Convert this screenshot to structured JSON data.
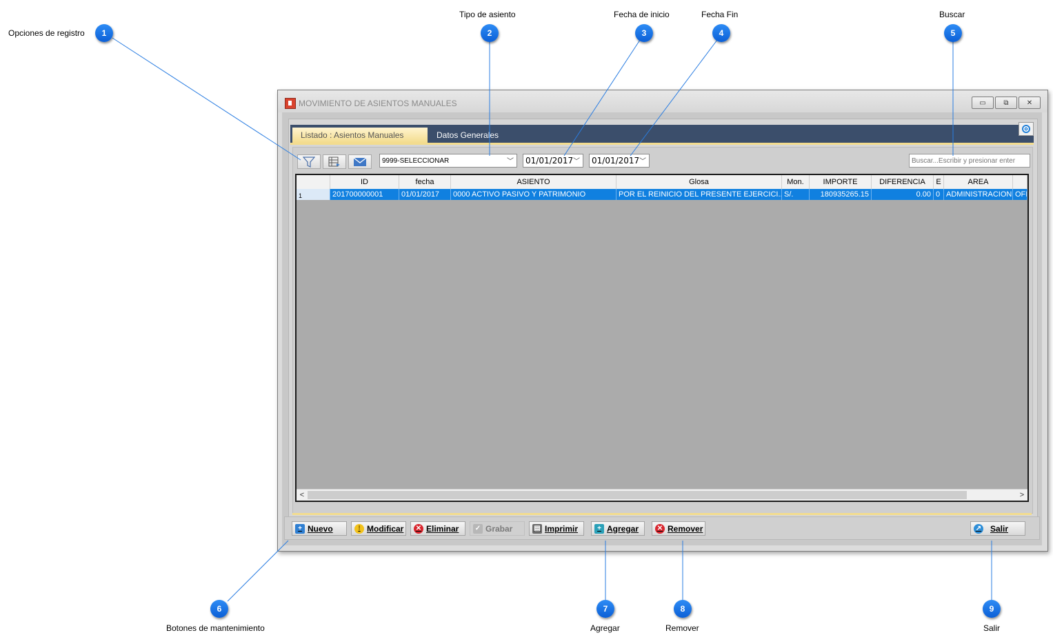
{
  "callouts": [
    {
      "num": "1",
      "label": "Opciones de registro"
    },
    {
      "num": "2",
      "label": "Tipo de asiento"
    },
    {
      "num": "3",
      "label": "Fecha de inicio"
    },
    {
      "num": "4",
      "label": "Fecha Fin"
    },
    {
      "num": "5",
      "label": "Buscar"
    },
    {
      "num": "6",
      "label": "Botones de mantenimiento"
    },
    {
      "num": "7",
      "label": "Agregar"
    },
    {
      "num": "8",
      "label": "Remover"
    },
    {
      "num": "9",
      "label": "Salir"
    }
  ],
  "window": {
    "title": "MOVIMIENTO DE ASIENTOS MANUALES",
    "minimize": "▭",
    "restore": "⧉",
    "close": "✕"
  },
  "tabs": [
    {
      "label": "Listado : Asientos Manuales"
    },
    {
      "label": "Datos Generales"
    }
  ],
  "toolbar": {
    "tipo_asiento": "9999-SELECCIONAR",
    "fecha_inicio": "01/01/2017",
    "fecha_fin": "01/01/2017",
    "search_placeholder": "Buscar...Escribir y presionar enter"
  },
  "grid": {
    "columns": [
      "",
      "ID",
      "fecha",
      "ASIENTO",
      "Glosa",
      "Mon.",
      "IMPORTE",
      "DIFERENCIA",
      "E",
      "AREA",
      ""
    ],
    "rows": [
      {
        "rownum": "1",
        "id": "201700000001",
        "fecha": "01/01/2017",
        "asiento": "0000 ACTIVO PASIVO Y PATRIMONIO",
        "glosa": "POR EL REINICIO DEL PRESENTE EJERCICI...",
        "mon": "S/.",
        "importe": "180935265.15",
        "diferencia": "0.00",
        "e": "0",
        "area": "ADMINISTRACION",
        "extra": "OFIC"
      }
    ],
    "scroll_left": "<",
    "scroll_right": ">"
  },
  "footer": {
    "nuevo": "Nuevo",
    "modificar": "Modificar",
    "eliminar": "Eliminar",
    "grabar": "Grabar",
    "imprimir": "Imprimir",
    "agregar": "Agregar",
    "remover": "Remover",
    "salir": "Salir"
  },
  "colors": {
    "accent_blue": "#1080e0",
    "tab_bar": "#3b4e6b",
    "tab_active": "#f3dc8e",
    "badge": "#0b5fd6"
  }
}
